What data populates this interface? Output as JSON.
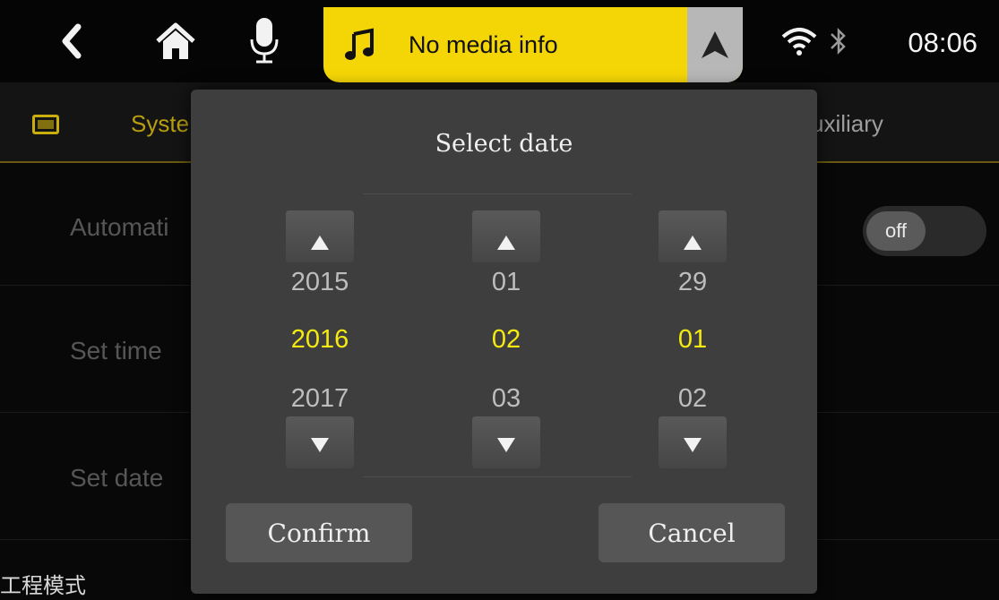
{
  "status_bar": {
    "icons": [
      "back-chevron-icon",
      "home-icon",
      "microphone-icon",
      "music-note-icon",
      "navigation-arrow-icon",
      "wifi-icon",
      "bluetooth-icon"
    ],
    "media_text": "No media info",
    "time": "08:06",
    "accent_color": "#f4d606"
  },
  "settings_page": {
    "tabs": [
      {
        "label": "Syste",
        "active": true
      },
      {
        "label": "uxiliary",
        "active": false
      }
    ],
    "rows": [
      {
        "label": "Automati",
        "toggle_value": "off"
      },
      {
        "label": "Set time"
      },
      {
        "label": "Set date"
      }
    ],
    "engineering_mode_label": "工程模式"
  },
  "dialog": {
    "title": "Select date",
    "year": {
      "prev": "2015",
      "selected": "2016",
      "next": "2017"
    },
    "month": {
      "prev": "01",
      "selected": "02",
      "next": "03"
    },
    "day": {
      "prev": "29",
      "selected": "01",
      "next": "02"
    },
    "confirm_label": "Confirm",
    "cancel_label": "Cancel",
    "selected_color": "#f4e910"
  }
}
